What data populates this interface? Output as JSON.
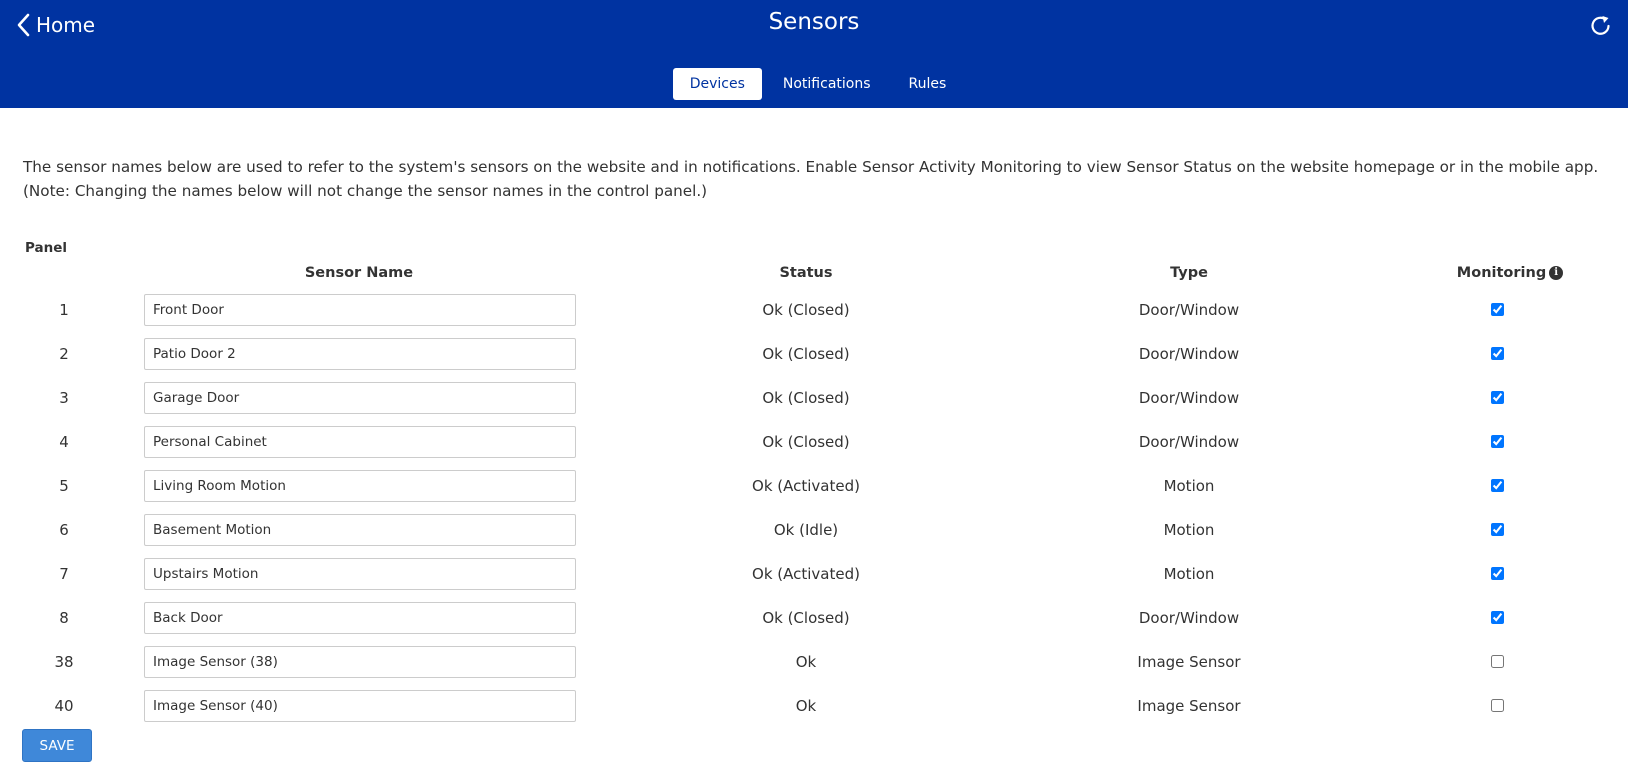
{
  "header": {
    "back_label": "Home",
    "title": "Sensors",
    "colors": {
      "bar": "#0033a1",
      "tab_active_text": "#0033a1"
    }
  },
  "tabs": [
    {
      "label": "Devices",
      "active": true
    },
    {
      "label": "Notifications",
      "active": false
    },
    {
      "label": "Rules",
      "active": false
    }
  ],
  "intro": {
    "line1": "The sensor names below are used to refer to the system's sensors on the website and in notifications. Enable Sensor Activity Monitoring to view Sensor Status on the website homepage or in the mobile app.",
    "line2": "(Note: Changing the names below will not change the sensor names in the control panel.)"
  },
  "table": {
    "panel_header": "Panel",
    "columns": {
      "name": "Sensor Name",
      "status": "Status",
      "type": "Type",
      "monitoring": "Monitoring"
    },
    "rows": [
      {
        "panel": "1",
        "name": "Front Door",
        "status": "Ok (Closed)",
        "type": "Door/Window",
        "monitoring": true
      },
      {
        "panel": "2",
        "name": "Patio Door 2",
        "status": "Ok (Closed)",
        "type": "Door/Window",
        "monitoring": true
      },
      {
        "panel": "3",
        "name": "Garage Door",
        "status": "Ok (Closed)",
        "type": "Door/Window",
        "monitoring": true
      },
      {
        "panel": "4",
        "name": "Personal Cabinet",
        "status": "Ok (Closed)",
        "type": "Door/Window",
        "monitoring": true
      },
      {
        "panel": "5",
        "name": "Living Room Motion",
        "status": "Ok (Activated)",
        "type": "Motion",
        "monitoring": true
      },
      {
        "panel": "6",
        "name": "Basement Motion",
        "status": "Ok (Idle)",
        "type": "Motion",
        "monitoring": true
      },
      {
        "panel": "7",
        "name": "Upstairs Motion",
        "status": "Ok (Activated)",
        "type": "Motion",
        "monitoring": true
      },
      {
        "panel": "8",
        "name": "Back Door",
        "status": "Ok (Closed)",
        "type": "Door/Window",
        "monitoring": true
      },
      {
        "panel": "38",
        "name": "Image Sensor (38)",
        "status": "Ok",
        "type": "Image Sensor",
        "monitoring": false
      },
      {
        "panel": "40",
        "name": "Image Sensor (40)",
        "status": "Ok",
        "type": "Image Sensor",
        "monitoring": false
      }
    ]
  },
  "save_label": "SAVE",
  "icons": {
    "back": "chevron-left-icon",
    "refresh": "refresh-icon",
    "info": "info-icon"
  }
}
